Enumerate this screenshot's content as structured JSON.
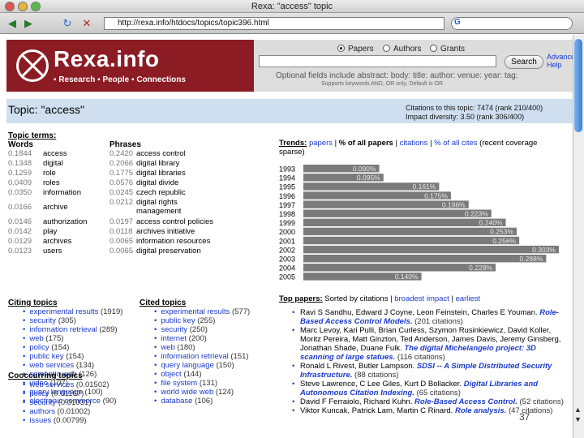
{
  "window": {
    "title": "Rexa: \"access\" topic"
  },
  "browser": {
    "url": "http://rexa.info/htdocs/topics/topic396.html",
    "search_logo": "G"
  },
  "header": {
    "logo": "Rexa.info",
    "tagline": "▪ Research ▪ People ▪ Connections",
    "search_modes": [
      "Papers",
      "Authors",
      "Grants"
    ],
    "search_button": "Search",
    "advanced_link": "Advanced Help",
    "optional_fields": "Optional fields include abstract: body: title: author: venue: year: tag:",
    "boolean_note": "Supports keywords AND, OR only, Default is OR"
  },
  "topic": {
    "title": "Topic: \"access\"",
    "citations": "Citations to this topic: 7474 (rank 210/400)",
    "impact": "Impact diversity: 3.50 (rank 306/400)"
  },
  "topic_terms": {
    "heading": "Topic terms:",
    "words_header": "Words",
    "phrases_header": "Phrases",
    "words": [
      {
        "score": "0.1844",
        "term": "access"
      },
      {
        "score": "0.1348",
        "term": "digital"
      },
      {
        "score": "0.1259",
        "term": "role"
      },
      {
        "score": "0.0409",
        "term": "roles"
      },
      {
        "score": "0.0350",
        "term": "information"
      },
      {
        "score": "0.0166",
        "term": "archive"
      },
      {
        "score": "0.0146",
        "term": "authorization"
      },
      {
        "score": "0.0142",
        "term": "play"
      },
      {
        "score": "0.0129",
        "term": "archives"
      },
      {
        "score": "0.0123",
        "term": "users"
      }
    ],
    "phrases": [
      {
        "score": "0.2420",
        "term": "access control"
      },
      {
        "score": "0.2066",
        "term": "digital library"
      },
      {
        "score": "0.1775",
        "term": "digital libraries"
      },
      {
        "score": "0.0576",
        "term": "digital divide"
      },
      {
        "score": "0.0245",
        "term": "czech republic"
      },
      {
        "score": "0.0212",
        "term": "digital rights management"
      },
      {
        "score": "0.0197",
        "term": "access control policies"
      },
      {
        "score": "0.0118",
        "term": "archives initiative"
      },
      {
        "score": "0.0065",
        "term": "information resources"
      },
      {
        "score": "0.0065",
        "term": "digital preservation"
      }
    ]
  },
  "citing_topics": {
    "heading": "Citing topics",
    "items": [
      {
        "name": "experimental results",
        "count": "(1919)"
      },
      {
        "name": "security",
        "count": "(305)"
      },
      {
        "name": "information retrieval",
        "count": "(289)"
      },
      {
        "name": "web",
        "count": "(175)"
      },
      {
        "name": "policy",
        "count": "(154)"
      },
      {
        "name": "public key",
        "count": "(154)"
      },
      {
        "name": "web services",
        "count": "(134)"
      },
      {
        "name": "semantic web",
        "count": "(126)"
      },
      {
        "name": "video",
        "count": "(107)"
      },
      {
        "name": "query language",
        "count": "(100)"
      },
      {
        "name": "electronic commerce",
        "count": "(90)"
      }
    ]
  },
  "cited_topics": {
    "heading": "Cited topics",
    "items": [
      {
        "name": "experimental results",
        "count": "(577)"
      },
      {
        "name": "public key",
        "count": "(255)"
      },
      {
        "name": "security",
        "count": "(250)"
      },
      {
        "name": "internet",
        "count": "(200)"
      },
      {
        "name": "web",
        "count": "(180)"
      },
      {
        "name": "information retrieval",
        "count": "(151)"
      },
      {
        "name": "query language",
        "count": "(150)"
      },
      {
        "name": "object",
        "count": "(144)"
      },
      {
        "name": "file system",
        "count": "(131)"
      },
      {
        "name": "world wide web",
        "count": "(124)"
      },
      {
        "name": "database",
        "count": "(106)"
      }
    ]
  },
  "cooccurring_topics": {
    "heading": "Cooccurring topics",
    "items": [
      {
        "name": "web services",
        "count": "(0.01502)"
      },
      {
        "name": "policy",
        "count": "(0.01167)"
      },
      {
        "name": "security",
        "count": "(0.01031)"
      },
      {
        "name": "authors",
        "count": "(0.01002)"
      },
      {
        "name": "issues",
        "count": "(0.00799)"
      }
    ]
  },
  "trends": {
    "label": "Trends:",
    "opt_papers": "papers",
    "sep1": " | ",
    "opt_pct_papers": "% of all papers",
    "sep2": " | ",
    "opt_citations": "citations",
    "sep3": " | ",
    "opt_pct_citations": "% of all cites",
    "note": " (recent coverage sparse)"
  },
  "chart_data": {
    "type": "bar",
    "orientation": "horizontal",
    "categories": [
      "1993",
      "1994",
      "1995",
      "1996",
      "1997",
      "1998",
      "1999",
      "2000",
      "2001",
      "2002",
      "2003",
      "2004",
      "2005"
    ],
    "values": [
      0.09,
      0.095,
      0.161,
      0.175,
      0.196,
      0.223,
      0.24,
      0.253,
      0.256,
      0.303,
      0.288,
      0.228,
      0.14
    ],
    "labels": [
      "0.090%",
      "0.095%",
      "0.161%",
      "0.175%",
      "0.196%",
      "0.223%",
      "0.240%",
      "0.253%",
      "0.256%",
      "0.303%",
      "0.288%",
      "0.228%",
      "0.140%"
    ],
    "xlim": [
      0,
      0.303
    ],
    "bar_color": "#7a7a7a",
    "grid": false
  },
  "top_papers": {
    "label": "Top papers:",
    "sort_prefix": " Sorted by citations | ",
    "sort_broadest": "broadest impact",
    "sort_sep": " | ",
    "sort_earliest": "earliest",
    "items": [
      {
        "authors": "Ravi S Sandhu, Edward J Coyne, Leon Feinstein, Charles E Youman. ",
        "title": "Role-Based Access Control Models.",
        "cites": " (201 citations)"
      },
      {
        "authors": "Marc Levoy, Kari Pulli, Brian Curless, Szymon Rusinkiewicz, David Koller, Moritz Pereira, Matt Ginzton, Ted Anderson, James Davis, Jeremy Ginsberg, Jonathan Shade, Duane Fulk. ",
        "title": "The digital Michelangelo project: 3D scanning of large statues.",
        "cites": " (116 citations)"
      },
      {
        "authors": "Ronald L Rivest, Butler Lampson. ",
        "title": "SDSI -- A Simple Distributed Security Infrastructure.",
        "cites": " (88 citations)"
      },
      {
        "authors": "Steve Lawrence, C Lee Giles, Kurt D Bollacker. ",
        "title": "Digital Libraries and Autonomous Citation Indexing.",
        "cites": " (65 citations)"
      },
      {
        "authors": "David F Ferraiolo, Richard Kuhn. ",
        "title": "Role-Based Access Control.",
        "cites": " (52 citations)"
      },
      {
        "authors": "Viktor Kuncak, Patrick Lam, Martin C Rinard. ",
        "title": "Role analysis.",
        "cites": " (47 citations)"
      }
    ]
  },
  "slide_number": "37"
}
